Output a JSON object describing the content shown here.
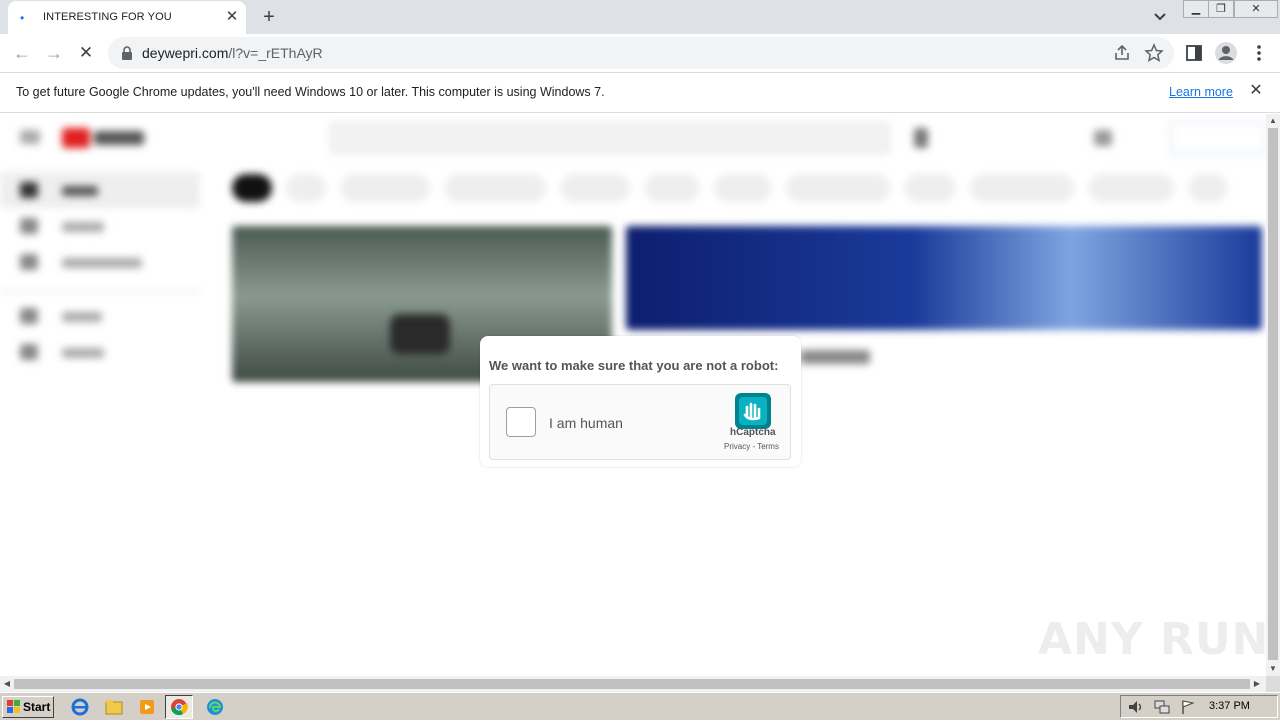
{
  "browser": {
    "tab_title": "INTERESTING FOR YOU",
    "url_host": "deywepri.com",
    "url_path": "/l?v=_rEThAyR",
    "infobar_message": "To get future Google Chrome updates, you'll need Windows 10 or later. This computer is using Windows 7.",
    "infobar_link": "Learn more"
  },
  "captcha": {
    "prompt": "We want to make sure that you are not a robot:",
    "checkbox_label": "I am human",
    "brand": "hCaptcha",
    "links": "Privacy - Terms"
  },
  "watermark": "ANY RUN",
  "taskbar": {
    "start_label": "Start",
    "clock": "3:37 PM"
  },
  "colors": {
    "chrome_accent": "#1a73e8",
    "hcaptcha_blue": "#00838f",
    "taskbar_bg": "#d4d0c8"
  },
  "icons": [
    "chrome-favicon-icon",
    "close-icon",
    "plus-icon",
    "chevron-down-icon",
    "back-icon",
    "forward-icon",
    "stop-icon",
    "lock-icon",
    "share-icon",
    "star-icon",
    "side-panel-icon",
    "profile-icon",
    "menu-icon",
    "hcaptcha-logo-icon",
    "ie-icon",
    "explorer-icon",
    "media-player-icon",
    "chrome-icon",
    "edge-icon",
    "volume-icon",
    "network-icon",
    "flag-icon"
  ]
}
